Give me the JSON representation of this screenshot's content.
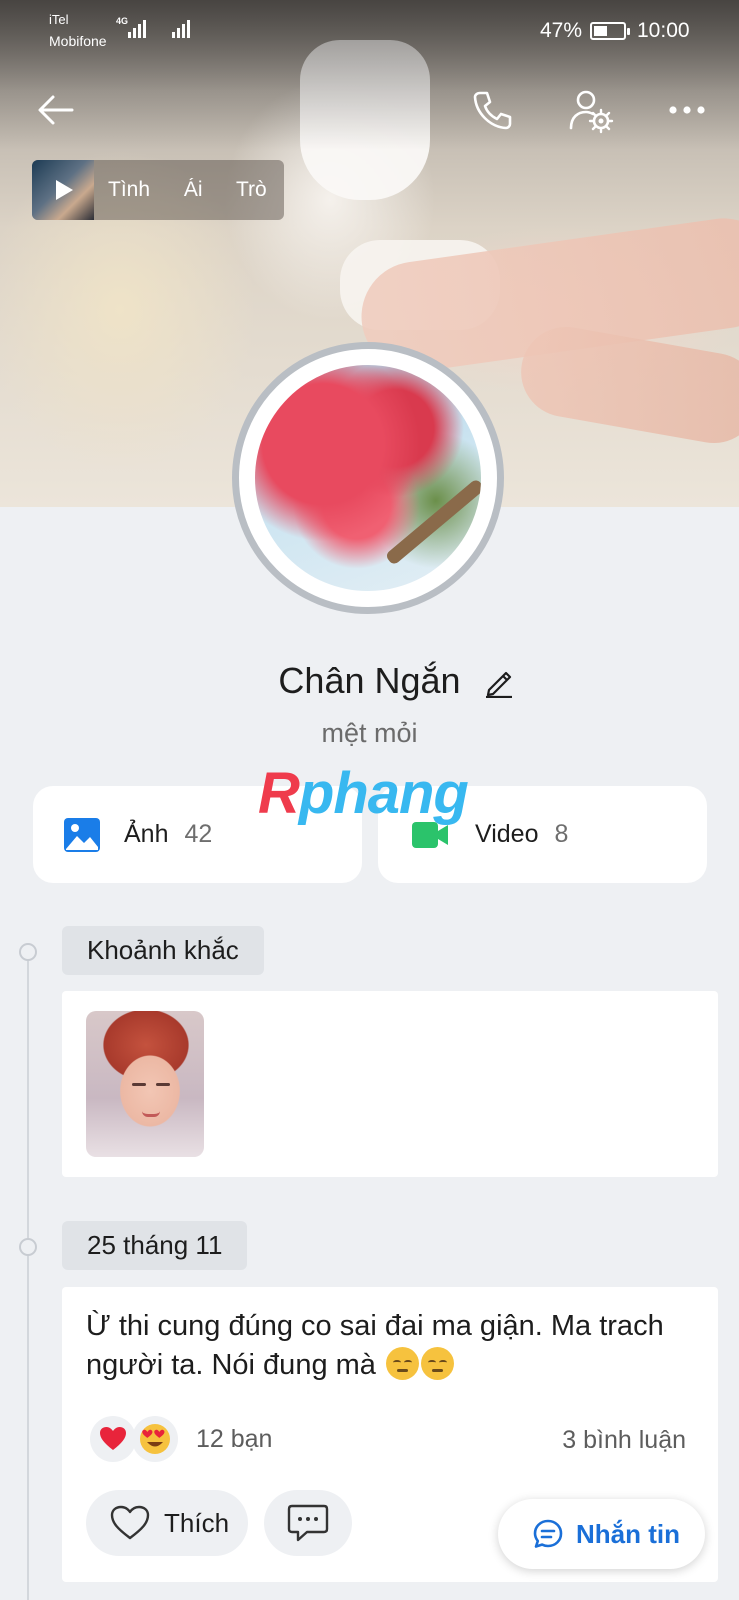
{
  "status_bar": {
    "carrier_1": "iTel",
    "carrier_2": "Mobifone",
    "network": "4G",
    "battery_percent": "47%",
    "battery_level": 0.47,
    "time": "10:00"
  },
  "music": {
    "title": "Tình Ái Trò"
  },
  "profile": {
    "name": "Chân Ngắn",
    "status": "mệt mỏi"
  },
  "watermark": {
    "first": "R",
    "rest": "phang"
  },
  "media": {
    "photos_label": "Ảnh",
    "photos_count": "42",
    "videos_label": "Video",
    "videos_count": "8"
  },
  "moments": {
    "label": "Khoảnh khắc"
  },
  "post": {
    "date": "25 tháng 11",
    "text": "Ừ thi cung đúng co sai đai ma giận. Ma trach người ta. Nói đung mà",
    "reactions_count": "12 bạn",
    "comments_count": "3 bình luận",
    "like_label": "Thích"
  },
  "fab": {
    "message_label": "Nhắn tin"
  },
  "colors": {
    "accent": "#1a6fd8",
    "photo_icon": "#1a7de8",
    "video_icon": "#2bc36b",
    "watermark_red": "#ef3b4c",
    "watermark_blue": "#38b8f0"
  }
}
